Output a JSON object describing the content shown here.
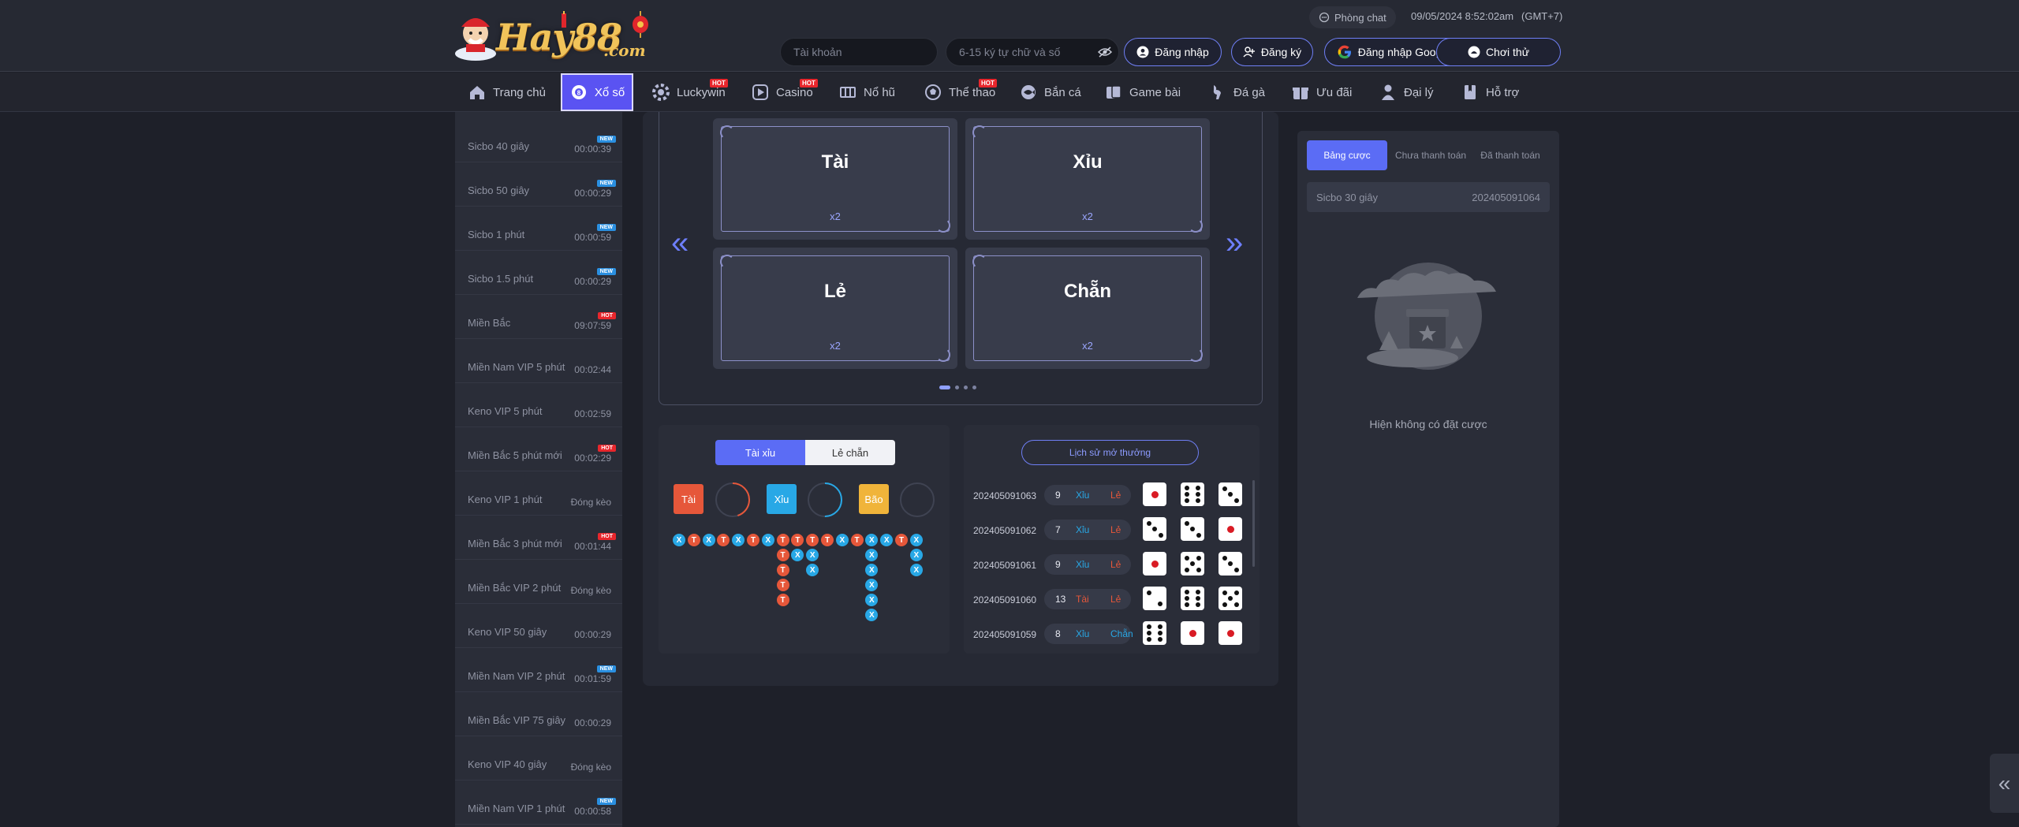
{
  "header": {
    "brand": "Hay88",
    "brand_suffix": ".com",
    "chat_label": "Phòng chat",
    "datetime": "09/05/2024 8:52:02am",
    "timezone": "(GMT+7)",
    "username_placeholder": "Tài khoản",
    "password_placeholder": "6-15 ký tự chữ và số",
    "login_label": "Đăng nhập",
    "register_label": "Đăng ký",
    "google_label": "Đăng nhập Google",
    "demo_label": "Chơi thử"
  },
  "nav": [
    {
      "label": "Trang chủ",
      "icon": "home-icon"
    },
    {
      "label": "Xổ số",
      "icon": "lottery-icon",
      "active": true
    },
    {
      "label": "Luckywin",
      "icon": "chip-icon",
      "badge": "HOT"
    },
    {
      "label": "Casino",
      "icon": "play-icon",
      "badge": "HOT"
    },
    {
      "label": "Nổ hũ",
      "icon": "slot-icon"
    },
    {
      "label": "Thể thao",
      "icon": "sport-icon",
      "badge": "HOT"
    },
    {
      "label": "Bắn cá",
      "icon": "fish-icon"
    },
    {
      "label": "Game bài",
      "icon": "cards-icon"
    },
    {
      "label": "Đá gà",
      "icon": "rooster-icon"
    },
    {
      "label": "Ưu đãi",
      "icon": "gift-icon"
    },
    {
      "label": "Đại lý",
      "icon": "agent-icon"
    },
    {
      "label": "Hỗ trợ",
      "icon": "book-icon"
    }
  ],
  "sidebar": [
    {
      "name": "Sicbo 40 giây",
      "time": "00:00:39",
      "tag": "NEW"
    },
    {
      "name": "Sicbo 50 giây",
      "time": "00:00:29",
      "tag": "NEW"
    },
    {
      "name": "Sicbo 1 phút",
      "time": "00:00:59",
      "tag": "NEW"
    },
    {
      "name": "Sicbo 1.5 phút",
      "time": "00:00:29",
      "tag": "NEW"
    },
    {
      "name": "Miền Bắc",
      "time": "09:07:59",
      "tag": "HOT"
    },
    {
      "name": "Miền Nam VIP 5 phút",
      "time": "00:02:44",
      "tag": ""
    },
    {
      "name": "Keno VIP 5 phút",
      "time": "00:02:59",
      "tag": ""
    },
    {
      "name": "Miền Bắc 5 phút mới",
      "time": "00:02:29",
      "tag": "HOT"
    },
    {
      "name": "Keno VIP 1 phút",
      "time": "Đóng kèo",
      "tag": ""
    },
    {
      "name": "Miền Bắc 3 phút mới",
      "time": "00:01:44",
      "tag": "HOT"
    },
    {
      "name": "Miền Bắc VIP 2 phút",
      "time": "Đóng kèo",
      "tag": ""
    },
    {
      "name": "Keno VIP 50 giây",
      "time": "00:00:29",
      "tag": ""
    },
    {
      "name": "Miền Nam VIP 2 phút",
      "time": "00:01:59",
      "tag": "NEW"
    },
    {
      "name": "Miền Bắc VIP 75 giây",
      "time": "00:00:29",
      "tag": ""
    },
    {
      "name": "Keno VIP 40 giây",
      "time": "Đóng kèo",
      "tag": ""
    },
    {
      "name": "Miền Nam VIP 1 phút",
      "time": "00:00:58",
      "tag": "NEW"
    }
  ],
  "bet_cards": [
    {
      "label": "Tài",
      "odds": "x2"
    },
    {
      "label": "Xỉu",
      "odds": "x2"
    },
    {
      "label": "Lẻ",
      "odds": "x2"
    },
    {
      "label": "Chẵn",
      "odds": "x2"
    }
  ],
  "stats": {
    "tab_active": "Tài xỉu",
    "tab_inactive": "Lẻ chẵn",
    "tai_label": "Tài",
    "xiu_label": "Xỉu",
    "bao_label": "Bão",
    "tai_pct": "",
    "xiu_pct": "",
    "bao_pct": "",
    "tai_frac": 0.45,
    "xiu_frac": 0.5,
    "bao_frac": 0.0,
    "bead_columns": [
      [
        "X"
      ],
      [
        "T"
      ],
      [
        "X"
      ],
      [
        "T"
      ],
      [
        "X"
      ],
      [
        "T"
      ],
      [
        "X"
      ],
      [
        "T",
        "T",
        "T",
        "T",
        "T"
      ],
      [
        "T",
        "X"
      ],
      [
        "T",
        "X",
        "X"
      ],
      [
        "T"
      ],
      [
        "X"
      ],
      [
        "T"
      ],
      [
        "X",
        "X",
        "X",
        "X",
        "X",
        "X"
      ],
      [
        "X"
      ],
      [
        "T"
      ],
      [
        "X",
        "X",
        "X"
      ]
    ]
  },
  "history": {
    "button_label": "Lịch sử mở thưởng",
    "rows": [
      {
        "id": "202405091063",
        "sum": "9",
        "size": "Xỉu",
        "parity": "Lẻ",
        "dice": [
          1,
          6,
          3
        ]
      },
      {
        "id": "202405091062",
        "sum": "7",
        "size": "Xỉu",
        "parity": "Lẻ",
        "dice": [
          3,
          3,
          1
        ]
      },
      {
        "id": "202405091061",
        "sum": "9",
        "size": "Xỉu",
        "parity": "Lẻ",
        "dice": [
          1,
          5,
          3
        ]
      },
      {
        "id": "202405091060",
        "sum": "13",
        "size": "Tài",
        "parity": "Lẻ",
        "dice": [
          2,
          6,
          5
        ]
      },
      {
        "id": "202405091059",
        "sum": "8",
        "size": "Xỉu",
        "parity": "Chẵn",
        "dice": [
          6,
          1,
          1
        ]
      }
    ]
  },
  "betpanel": {
    "tab1": "Bảng cược",
    "tab2": "Chưa thanh toán",
    "tab3": "Đã thanh toán",
    "game": "Sicbo 30 giây",
    "round": "202405091064",
    "empty_text": "Hiện không có đặt cược"
  },
  "colors": {
    "accent": "#5a53f2",
    "tai": "#e6573a",
    "xiu": "#28a8e6",
    "bao": "#f0b43a"
  }
}
